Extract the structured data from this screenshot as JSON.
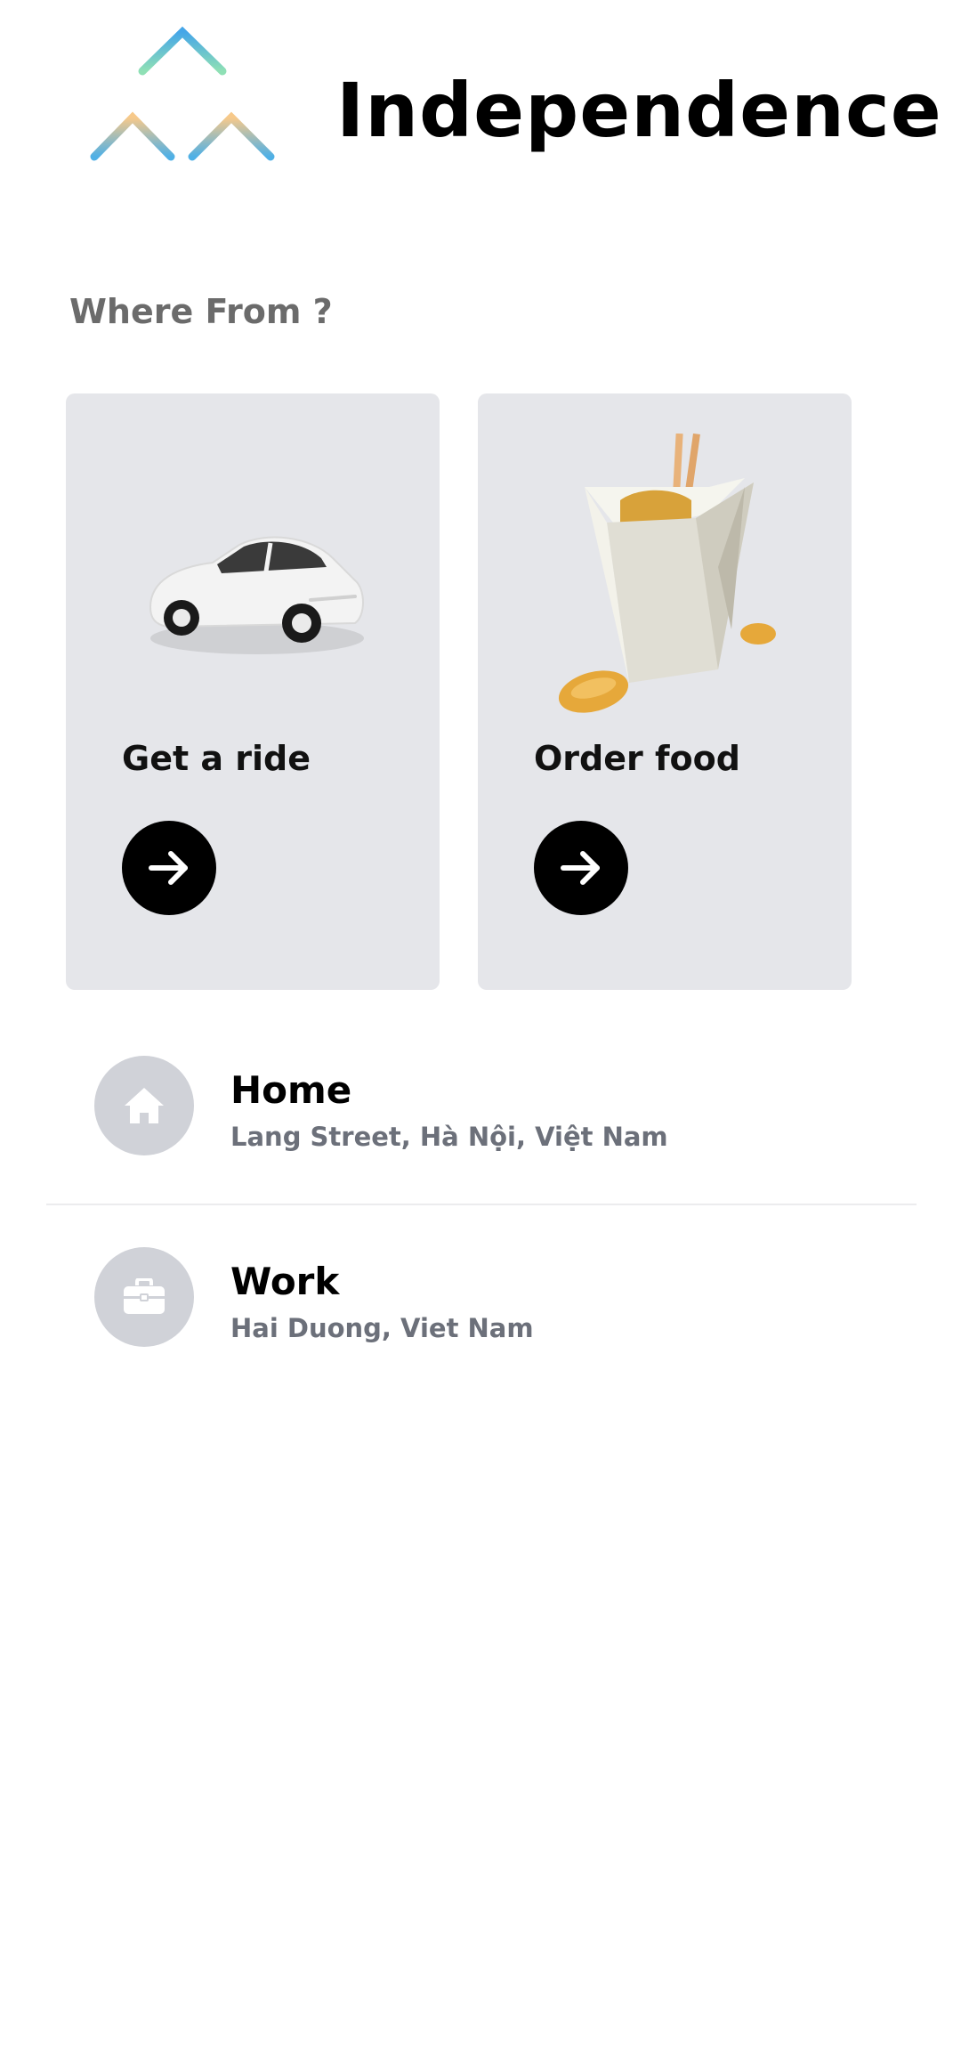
{
  "header": {
    "logo_icon": "three-houses-logo",
    "app_title": "Independence"
  },
  "section_label": "Where From ?",
  "services": [
    {
      "label": "Get a ride",
      "icon": "car-illustration",
      "action_icon": "arrow-right-icon"
    },
    {
      "label": "Order food",
      "icon": "takeout-box-illustration",
      "action_icon": "arrow-right-icon"
    }
  ],
  "saved_places": [
    {
      "name": "Home",
      "address": "Lang Street, Hà Nội, Việt Nam",
      "icon": "home-icon"
    },
    {
      "name": "Work",
      "address": "Hai Duong, Viet Nam",
      "icon": "briefcase-icon"
    }
  ],
  "colors": {
    "card_bg": "#e5e6ea",
    "place_icon_bg": "#d0d2d8",
    "action_button": "#000000",
    "secondary_text": "#6c707a"
  }
}
